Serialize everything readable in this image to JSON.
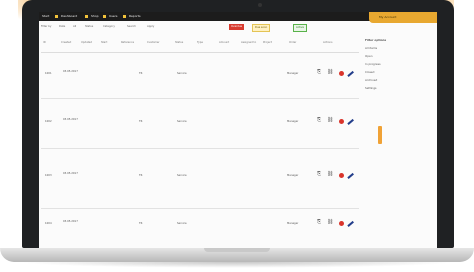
{
  "appbar": {
    "items": [
      "Start",
      "Dashboard",
      "Shop",
      "Users",
      "Reports"
    ],
    "user_label": "My Account"
  },
  "filters": {
    "labels": [
      "Filter by",
      "Date",
      "All",
      "Status",
      "Category",
      "Search",
      "Apply"
    ]
  },
  "badges": [
    "Overdue",
    "Due soon",
    "Active"
  ],
  "table": {
    "headers": [
      "ID",
      "Created",
      "Updated",
      "Start",
      "Reference",
      "Customer",
      "Status",
      "Type",
      "Amount",
      "Assigned to",
      "Project",
      "Order",
      "Actions"
    ],
    "rows": [
      {
        "id": "1001",
        "created": "03.05.2017",
        "ref": "TR",
        "customer": "Service",
        "status": "Open",
        "owner": "Manager"
      },
      {
        "id": "1002",
        "created": "03.05.2017",
        "ref": "TR",
        "customer": "Service",
        "status": "Open",
        "owner": "Manager"
      },
      {
        "id": "1003",
        "created": "03.05.2017",
        "ref": "TR",
        "customer": "Service",
        "status": "Open",
        "owner": "Manager"
      },
      {
        "id": "1004",
        "created": "03.05.2017",
        "ref": "TR",
        "customer": "Service",
        "status": "Open",
        "owner": "Manager"
      }
    ]
  },
  "sidebar": {
    "title": "Filter options",
    "items": [
      "All items",
      "Open",
      "In progress",
      "Closed",
      "Archived",
      "Settings"
    ]
  },
  "colors": {
    "accent": "#f1a740",
    "danger": "#d9342b",
    "edit": "#233e8b"
  }
}
